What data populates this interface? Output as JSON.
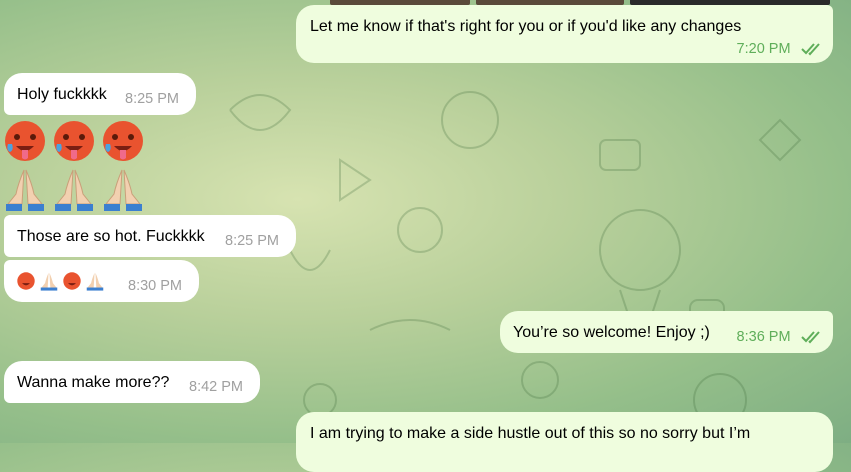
{
  "messages": [
    {
      "id": "m1",
      "dir": "out",
      "text": "Let me know if that's right for you or if you'd like any changes",
      "time": "7:20 PM"
    },
    {
      "id": "m2",
      "dir": "in",
      "text": "Holy fuckkkk",
      "time": "8:25 PM"
    },
    {
      "id": "m3",
      "dir": "in",
      "emoji_rows": [
        [
          "hot-face",
          "hot-face",
          "hot-face"
        ],
        [
          "folded-hands",
          "folded-hands",
          "folded-hands"
        ]
      ]
    },
    {
      "id": "m4",
      "dir": "in",
      "text": "Those are so hot. Fuckkkk",
      "time": "8:25 PM"
    },
    {
      "id": "m5",
      "dir": "in",
      "emoji_inline": [
        "hot-face",
        "folded-hands",
        "hot-face",
        "folded-hands"
      ],
      "time": "8:30 PM"
    },
    {
      "id": "m6",
      "dir": "out",
      "text": "You’re so welcome! Enjoy ;)",
      "time": "8:36 PM"
    },
    {
      "id": "m7",
      "dir": "in",
      "text": "Wanna make more??",
      "time": "8:42 PM"
    },
    {
      "id": "m8",
      "dir": "out",
      "text": "I am trying to make a side hustle out of this so no sorry but I’m"
    }
  ],
  "colors": {
    "outgoing_bubble": "#effdde",
    "incoming_bubble": "#ffffff",
    "read_check": "#5fae5a"
  }
}
